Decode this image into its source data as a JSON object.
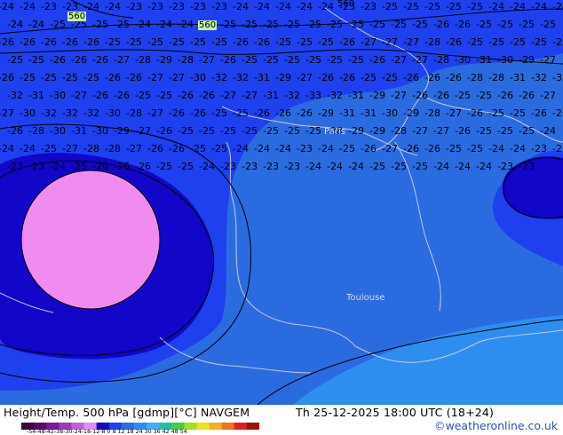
{
  "chart": {
    "product": "Height/Temp. 500 hPa [gdmp][°C] NAVGEM",
    "valid": "Th 25-12-2025 18:00 UTC (18+24)",
    "credit": "©weatheronline.co.uk",
    "colorbar_ticks": "-54-48-42-38-30-24-18-12-8  0  8  12  18  24  30  36  42  48  54",
    "colorbar_values": [
      -54,
      -48,
      -42,
      -38,
      -30,
      -24,
      -18,
      -12,
      -8,
      0,
      8,
      12,
      18,
      24,
      30,
      36,
      42,
      48,
      54
    ],
    "colors": {
      "t_warm": "#2b6be0",
      "t_mid": "#1e40ee",
      "t_cold": "#1206c8",
      "t_coldest": "#f08cf0",
      "t_warmest": "#2e8ef0",
      "contour": "#000000",
      "coast": "#c8c8d8",
      "height_label_bg": "#c0f0a0"
    },
    "height_labels": [
      "560",
      "560",
      "560"
    ],
    "cities": [
      "Paris",
      "Toulouse"
    ],
    "temperature_labels": [
      "-24",
      "-24",
      "-23",
      "-23",
      "-24",
      "-24",
      "-23",
      "-23",
      "-23",
      "-23",
      "-23",
      "-24",
      "-24",
      "-24",
      "-24",
      "-24",
      "-23",
      "-23",
      "-25",
      "-25",
      "-25",
      "-25",
      "-25",
      "-24",
      "-24",
      "-24",
      "-24",
      "-24",
      "-24",
      "-25",
      "-25",
      "-25",
      "-25",
      "-24",
      "-24",
      "-24",
      "-23",
      "-25",
      "-25",
      "-25",
      "-25",
      "-25",
      "-25",
      "-25",
      "-25",
      "-25",
      "-25",
      "-26",
      "-26",
      "-25",
      "-25",
      "-25",
      "-25",
      "-26",
      "-26",
      "-26",
      "-26",
      "-26",
      "-25",
      "-25",
      "-25",
      "-25",
      "-25",
      "-25",
      "-26",
      "-26",
      "-25",
      "-25",
      "-25",
      "-26",
      "-27",
      "-27",
      "-27",
      "-28",
      "-26",
      "-25",
      "-25",
      "-25",
      "-25",
      "-25",
      "-25",
      "-25",
      "-26",
      "-26",
      "-26",
      "-27",
      "-28",
      "-29",
      "-28",
      "-27",
      "-26",
      "-25",
      "-25",
      "-25",
      "-25",
      "-25",
      "-25",
      "-26",
      "-27",
      "-27",
      "-28",
      "-30",
      "-31",
      "-30",
      "-29",
      "-27",
      "-26",
      "-25",
      "-25",
      "-25",
      "-25",
      "-26",
      "-26",
      "-27",
      "-27",
      "-30",
      "-32",
      "-32",
      "-31",
      "-29",
      "-27",
      "-26",
      "-26",
      "-25",
      "-25",
      "-26",
      "-26",
      "-26",
      "-28",
      "-28",
      "-31",
      "-32",
      "-33",
      "-32",
      "-31",
      "-30",
      "-27",
      "-26",
      "-26",
      "-25",
      "-25",
      "-26",
      "-26",
      "-27",
      "-27",
      "-31",
      "-32",
      "-33",
      "-32",
      "-31",
      "-29",
      "-27",
      "-26",
      "-26",
      "-25",
      "-25",
      "-26",
      "-26",
      "-27",
      "-27",
      "-30",
      "-32",
      "-32",
      "-32",
      "-30",
      "-28",
      "-27",
      "-26",
      "-26",
      "-25",
      "-25",
      "-26",
      "-26",
      "-26",
      "-29",
      "-31",
      "-31",
      "-30",
      "-29",
      "-28",
      "-27",
      "-26",
      "-25",
      "-25",
      "-26",
      "-26",
      "-26",
      "-28",
      "-30",
      "-31",
      "-30",
      "-29",
      "-27",
      "-26",
      "-25",
      "-25",
      "-25",
      "-25",
      "-25",
      "-25",
      "-25",
      "-28",
      "-29",
      "-29",
      "-28",
      "-27",
      "-27",
      "-26",
      "-25",
      "-25",
      "-25",
      "-24",
      "-24",
      "-24",
      "-25",
      "-27",
      "-28",
      "-28",
      "-27",
      "-26",
      "-26",
      "-25",
      "-25",
      "-24",
      "-24",
      "-24",
      "-23",
      "-24",
      "-25",
      "-26",
      "-27",
      "-26",
      "-26",
      "-25",
      "-25",
      "-24",
      "-24",
      "-23",
      "-23",
      "-23",
      "-23",
      "-24",
      "-25",
      "-26",
      "-26",
      "-26",
      "-25",
      "-25",
      "-24",
      "-23",
      "-23",
      "-23",
      "-23",
      "-24",
      "-24",
      "-24",
      "-25",
      "-25",
      "-25",
      "-24",
      "-24",
      "-24",
      "-23",
      "-23"
    ]
  }
}
